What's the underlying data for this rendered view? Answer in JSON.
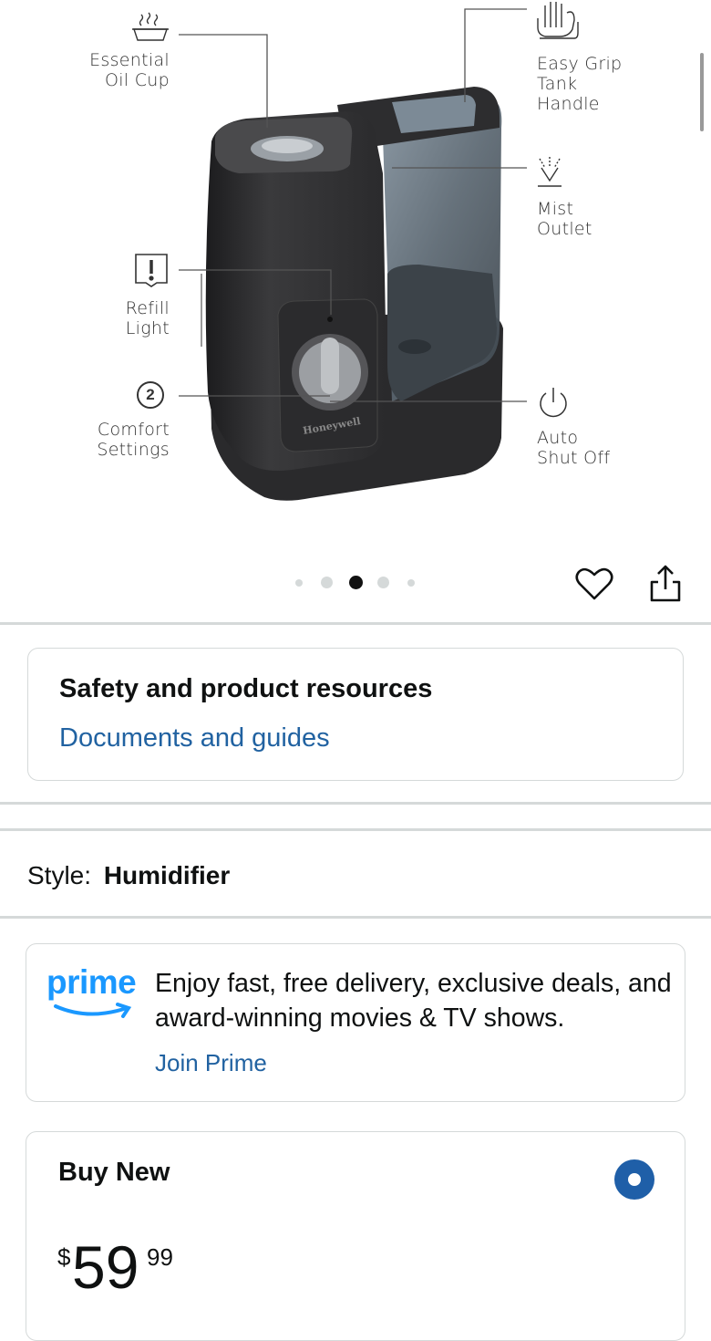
{
  "product_image": {
    "brand": "Honeywell",
    "callouts": {
      "oil_cup": [
        "Essential",
        "Oil Cup"
      ],
      "tank_handle": [
        "Easy Grip",
        "Tank",
        "Handle"
      ],
      "mist_outlet": [
        "Mist",
        "Outlet"
      ],
      "refill_light": [
        "Refill",
        "Light"
      ],
      "comfort_settings": [
        "Comfort",
        "Settings"
      ],
      "auto_shutoff": [
        "Auto",
        "Shut Off"
      ],
      "comfort_badge": "2"
    },
    "carousel": {
      "total": 5,
      "active_index": 2
    }
  },
  "safety": {
    "title": "Safety and product resources",
    "link": "Documents and guides"
  },
  "style": {
    "label": "Style:",
    "value": "Humidifier"
  },
  "prime": {
    "logo": "prime",
    "text": "Enjoy fast, free delivery, exclusive deals, and award-winning movies & TV shows.",
    "link": "Join Prime"
  },
  "buy_new": {
    "title": "Buy New",
    "price_symbol": "$",
    "price_whole": "59",
    "price_fraction": "99"
  },
  "icons": {
    "heart": "heart-icon",
    "share": "share-icon",
    "radio": "radio-selected-icon"
  },
  "colors": {
    "link": "#2162a1",
    "radio": "#1f5fa8",
    "divider": "#d5d9d9",
    "prime": "#1a98ff"
  }
}
